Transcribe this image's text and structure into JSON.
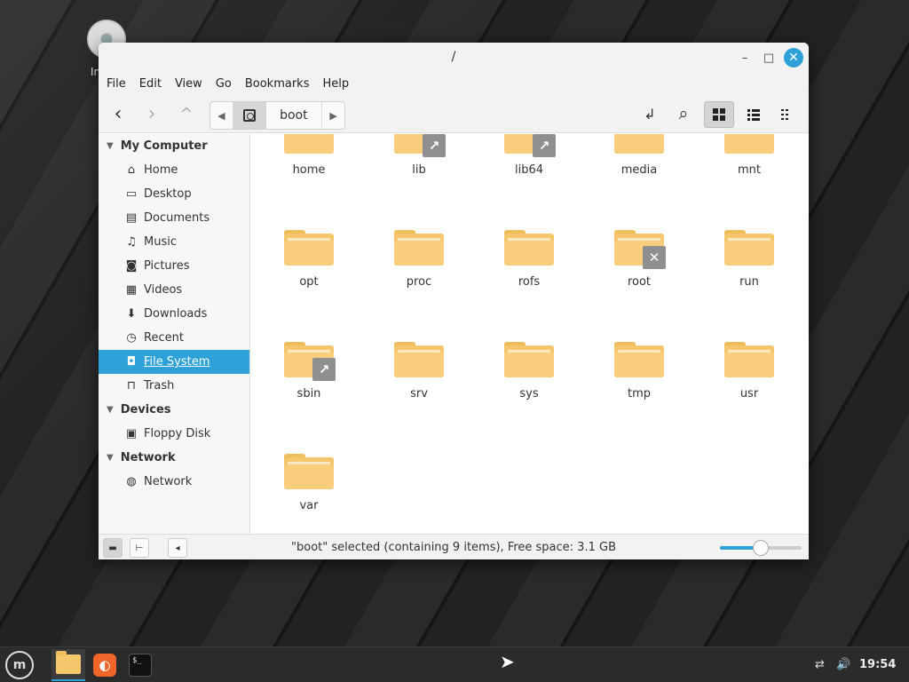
{
  "desktop": {
    "icon_label": "In"
  },
  "window": {
    "title": "/",
    "controls": {
      "minimize": "–",
      "maximize": "□",
      "close": "✕"
    }
  },
  "menubar": [
    "File",
    "Edit",
    "View",
    "Go",
    "Bookmarks",
    "Help"
  ],
  "toolbar": {
    "back": "‹",
    "forward": "›",
    "up": "^",
    "path": {
      "current": "boot"
    },
    "toggle_location": "↲",
    "search": "⌕"
  },
  "sidebar": {
    "sections": [
      {
        "label": "My Computer",
        "items": [
          {
            "label": "Home",
            "icon": "home-icon",
            "glyph": "⌂"
          },
          {
            "label": "Desktop",
            "icon": "desktop-icon",
            "glyph": "▭"
          },
          {
            "label": "Documents",
            "icon": "documents-icon",
            "glyph": "▤"
          },
          {
            "label": "Music",
            "icon": "music-icon",
            "glyph": "♫"
          },
          {
            "label": "Pictures",
            "icon": "pictures-icon",
            "glyph": "◙"
          },
          {
            "label": "Videos",
            "icon": "videos-icon",
            "glyph": "▦"
          },
          {
            "label": "Downloads",
            "icon": "downloads-icon",
            "glyph": "⬇"
          },
          {
            "label": "Recent",
            "icon": "recent-icon",
            "glyph": "◷"
          },
          {
            "label": "File System",
            "icon": "filesystem-icon",
            "glyph": "◘",
            "selected": true
          },
          {
            "label": "Trash",
            "icon": "trash-icon",
            "glyph": "🗑"
          }
        ]
      },
      {
        "label": "Devices",
        "items": [
          {
            "label": "Floppy Disk",
            "icon": "floppy-icon",
            "glyph": "▣"
          }
        ]
      },
      {
        "label": "Network",
        "items": [
          {
            "label": "Network",
            "icon": "network-icon",
            "glyph": "◍"
          }
        ]
      }
    ]
  },
  "files": [
    {
      "name": "home"
    },
    {
      "name": "lib",
      "emblem": "↗"
    },
    {
      "name": "lib64",
      "emblem": "↗"
    },
    {
      "name": "media"
    },
    {
      "name": "mnt"
    },
    {
      "name": "opt"
    },
    {
      "name": "proc"
    },
    {
      "name": "rofs"
    },
    {
      "name": "root",
      "emblem": "✕"
    },
    {
      "name": "run"
    },
    {
      "name": "sbin",
      "emblem": "↗"
    },
    {
      "name": "srv"
    },
    {
      "name": "sys"
    },
    {
      "name": "tmp"
    },
    {
      "name": "usr"
    },
    {
      "name": "var"
    }
  ],
  "statusbar": {
    "text": "\"boot\" selected (containing 9 items), Free space: 3.1 GB",
    "zoom_level": 0.5
  },
  "taskbar": {
    "clock": "19:54",
    "apps": [
      "file-manager",
      "firefox",
      "terminal"
    ],
    "terminal_text": "$_"
  }
}
